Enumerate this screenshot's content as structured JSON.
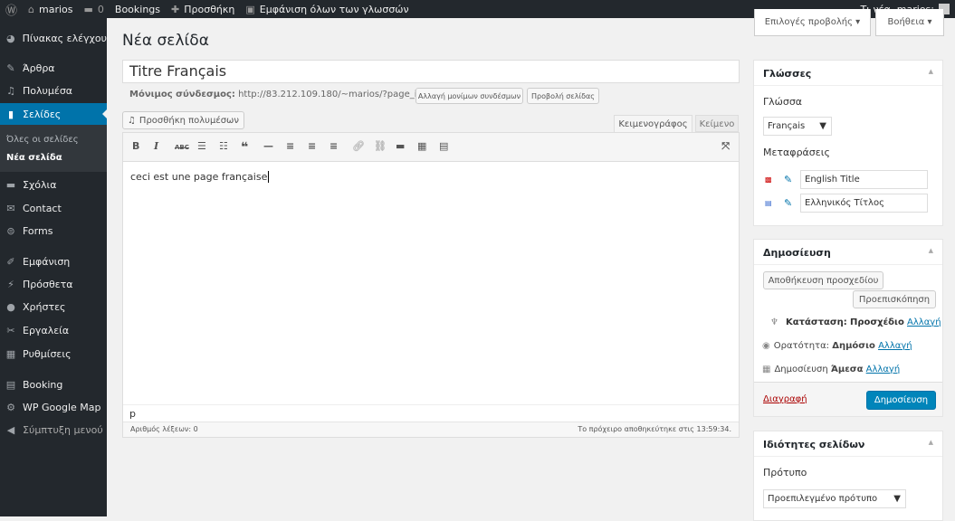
{
  "adminbar": {
    "site": "marios",
    "comments": "0",
    "bookings": "Bookings",
    "add": "Προσθήκη",
    "languages": "Εμφάνιση όλων των γλωσσών",
    "greeting": "Τι νέα, marios;"
  },
  "sidebar": {
    "items": [
      "Πίνακας ελέγχου",
      "Άρθρα",
      "Πολυμέσα",
      "Σελίδες",
      "Σχόλια",
      "Contact",
      "Forms",
      "Εμφάνιση",
      "Πρόσθετα",
      "Χρήστες",
      "Εργαλεία",
      "Ρυθμίσεις",
      "Booking",
      "WP Google Map",
      "Σύμπτυξη μενού"
    ],
    "submenu": [
      "Όλες οι σελίδες",
      "Νέα σελίδα"
    ]
  },
  "screen": {
    "options": "Επιλογές προβολής ▾",
    "help": "Βοήθεια ▾"
  },
  "page": {
    "title": "Νέα σελίδα",
    "post_title": "Titre Français",
    "permalink_label": "Μόνιμος σύνδεσμος:",
    "permalink": "http://83.212.109.180/~marios/?page_id=18",
    "change_permalink": "Αλλαγή μονίμων συνδέσμων",
    "view_page": "Προβολή σελίδας"
  },
  "editor": {
    "add_media": "Προσθήκη πολυμέσων",
    "tab_visual": "Κειμενογράφος",
    "tab_text": "Κείμενο",
    "content": "ceci est une page française",
    "path": "p",
    "word_count": "Αριθμός λέξεων: 0",
    "draft_saved": "Το πρόχειρο αποθηκεύτηκε στις 13:59:34."
  },
  "languages_box": {
    "title": "Γλώσσες",
    "language_label": "Γλώσσα",
    "language": "Français",
    "translations_label": "Μεταφράσεις",
    "translations": [
      "English Title",
      "Ελληνικός Τίτλος"
    ]
  },
  "publish_box": {
    "title": "Δημοσίευση",
    "save_draft": "Αποθήκευση προσχεδίου",
    "preview": "Προεπισκόπηση",
    "status_label": "Κατάσταση:",
    "status": "Προσχέδιο",
    "visibility_label": "Ορατότητα:",
    "visibility": "Δημόσιο",
    "publish_label": "Δημοσίευση",
    "publish_when": "Άμεσα",
    "edit": "Αλλαγή",
    "delete": "Διαγραφή",
    "publish": "Δημοσίευση"
  },
  "attributes_box": {
    "title": "Ιδιότητες σελίδων",
    "template_label": "Πρότυπο",
    "template": "Προεπιλεγμένο πρότυπο"
  },
  "colors": {
    "accent": "#0073aa",
    "adminbar": "#23282d",
    "delete": "#a00"
  }
}
